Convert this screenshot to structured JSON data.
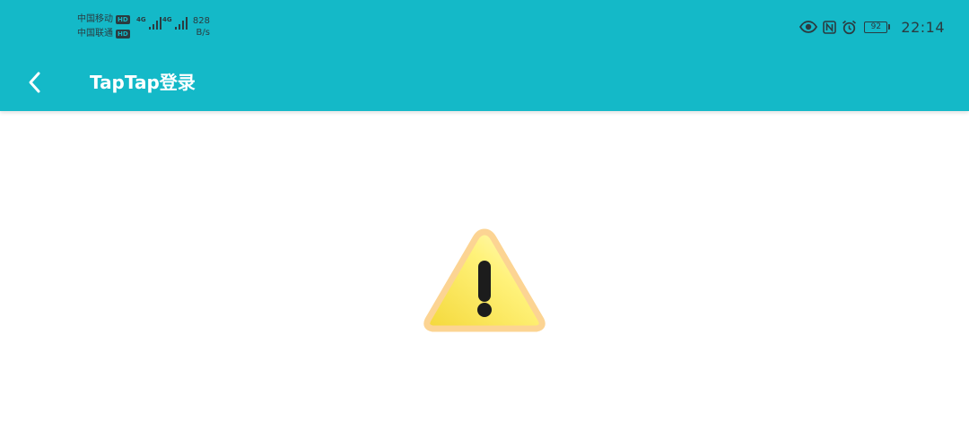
{
  "status_bar": {
    "carrier_1": "中国移动",
    "carrier_2": "中国联通",
    "hd_label": "HD",
    "network_1": "4G",
    "network_2": "4G",
    "net_speed_value": "828",
    "net_speed_unit": "B/s",
    "battery_level": "92",
    "time": "22:14",
    "icons": [
      "eye-icon",
      "nfc-icon",
      "alarm-icon",
      "battery-icon"
    ]
  },
  "app_bar": {
    "title": "TapTap登录",
    "back_icon": "chevron-left-icon",
    "background": "#14b9c8"
  },
  "content": {
    "icon": "warning-icon",
    "icon_colors": {
      "fill_top": "#fff59a",
      "fill_bottom": "#f7d84a",
      "border": "#fbd38e",
      "mark": "#1c1c1c"
    }
  }
}
